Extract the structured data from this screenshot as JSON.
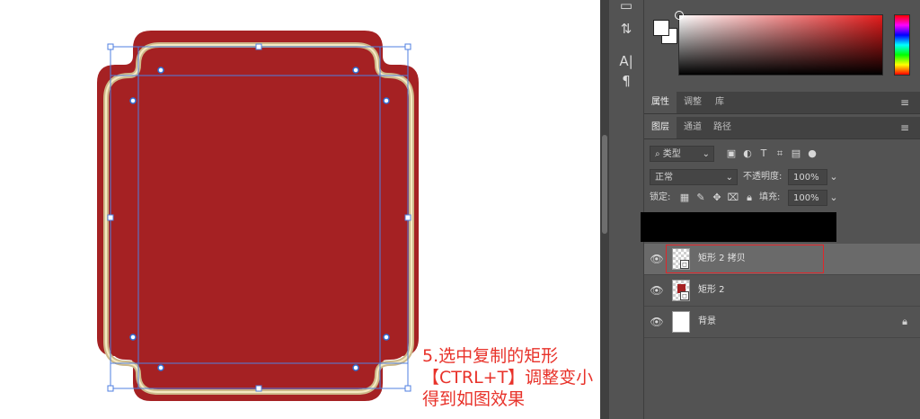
{
  "instruction": {
    "line1": "5.选中复制的矩形",
    "line2": "【CTRL+T】调整变小",
    "line3": "得到如图效果"
  },
  "colors": {
    "shape_fill": "#a52123",
    "stroke_outer": "#cdb98a",
    "stroke_inner": "#f5e9c2",
    "handle_blue": "#2f6fd6",
    "instruction_red": "#e8322a",
    "selection_red": "#e0262b"
  },
  "tools": {
    "tool1_icon": "layer-comp-icon",
    "tool2_label": "A|",
    "tool3_label": "¶"
  },
  "properties_tabs": [
    {
      "label": "属性",
      "active": true
    },
    {
      "label": "调整",
      "active": false
    },
    {
      "label": "库",
      "active": false
    }
  ],
  "layers_tabs": [
    {
      "label": "图层",
      "active": true
    },
    {
      "label": "通道",
      "active": false
    },
    {
      "label": "路径",
      "active": false
    }
  ],
  "filter": {
    "kind_label": "类型",
    "search_icon": "search-icon"
  },
  "blend": {
    "mode": "正常",
    "opacity_label": "不透明度:",
    "opacity_value": "100%"
  },
  "lock": {
    "label": "锁定:",
    "fill_label": "填充:",
    "fill_value": "100%"
  },
  "layers": [
    {
      "name": "矩形 2 拷贝",
      "selected": true,
      "thumb": "vector-shape"
    },
    {
      "name": "矩形 2",
      "selected": false,
      "thumb": "vector-shape-red"
    },
    {
      "name": "背景",
      "selected": false,
      "thumb": "white",
      "locked": true
    }
  ],
  "panel_menu_icon": "≡"
}
